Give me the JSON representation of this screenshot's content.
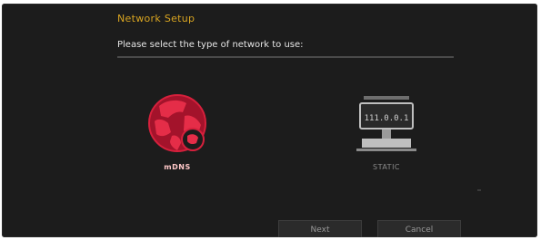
{
  "dialog": {
    "title": "Network Setup",
    "instruction": "Please select the type of network to use:"
  },
  "options": [
    {
      "id": "mdns",
      "label": "mDNS",
      "icon": "globe-icon",
      "selected": true,
      "color": "#d6203c"
    },
    {
      "id": "static",
      "label": "STATIC",
      "icon": "network-computer-icon",
      "selected": false,
      "color": "#bfbfbf",
      "screen_text": "111.0.0.1"
    }
  ],
  "buttons": {
    "next_label": "Next",
    "cancel_label": "Cancel"
  },
  "colors": {
    "background": "#1c1c1c",
    "title": "#d9a521",
    "accent": "#d6203c"
  }
}
